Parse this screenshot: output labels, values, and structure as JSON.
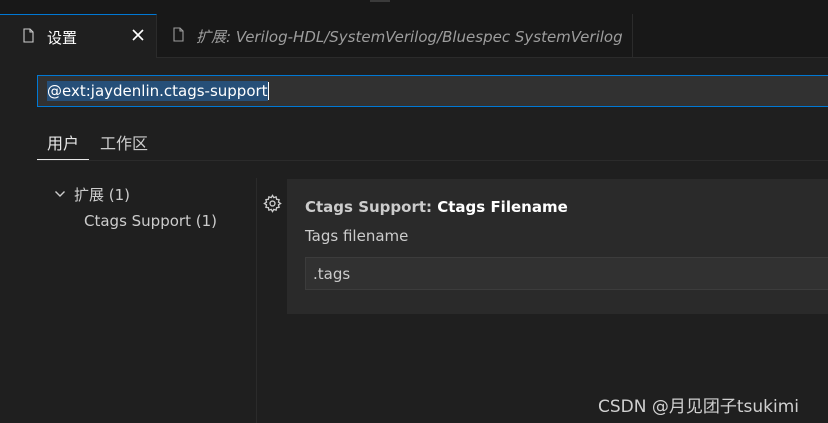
{
  "tabs": [
    {
      "label": "设置",
      "active": true
    },
    {
      "label": "扩展: Verilog-HDL/SystemVerilog/Bluespec SystemVerilog",
      "active": false
    }
  ],
  "search": {
    "value": "@ext:jaydenlin.ctags-support"
  },
  "scope_tabs": [
    {
      "label": "用户",
      "active": true
    },
    {
      "label": "工作区",
      "active": false
    }
  ],
  "toc": {
    "group_label": "扩展 (1)",
    "item_label": "Ctags Support (1)"
  },
  "setting": {
    "category": "Ctags Support: ",
    "name": "Ctags Filename",
    "description": "Tags filename",
    "value": ".tags"
  },
  "watermark": "CSDN @月见团子tsukimi",
  "colors": {
    "accent": "#0078d4",
    "background": "#1f1f1f",
    "selection": "#264f78"
  },
  "icons": {
    "tab_icon": "file-icon",
    "close": "close-icon",
    "chevron": "chevron-down-icon",
    "setting_gear": "gear-icon"
  }
}
